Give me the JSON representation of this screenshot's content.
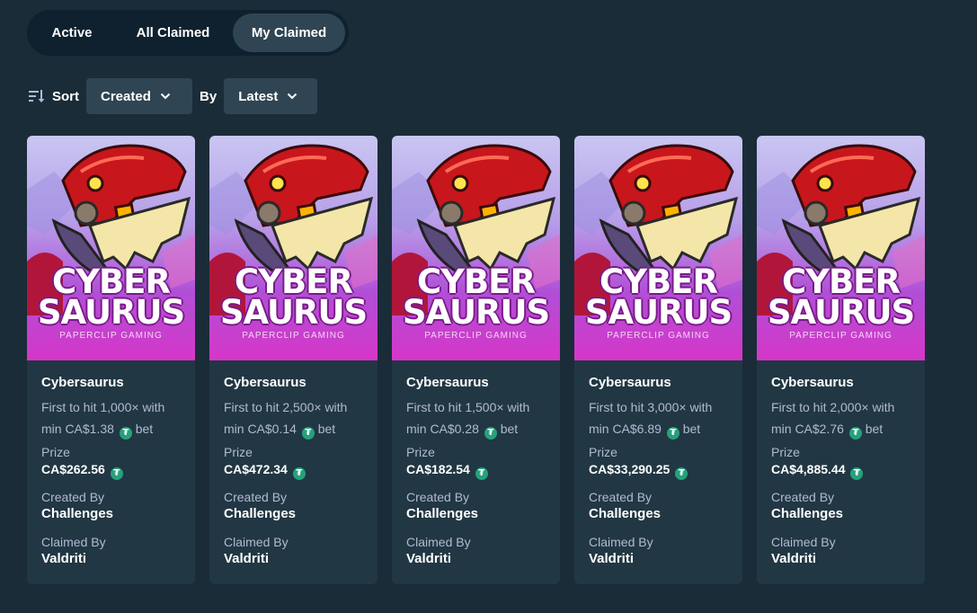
{
  "tabs": [
    {
      "label": "Active"
    },
    {
      "label": "All Claimed"
    },
    {
      "label": "My Claimed"
    }
  ],
  "sort": {
    "label": "Sort",
    "field": "Created",
    "by_label": "By",
    "order": "Latest"
  },
  "labels": {
    "prize": "Prize",
    "created_by": "Created By",
    "claimed_by": "Claimed By"
  },
  "game_art": {
    "line1": "CYBER",
    "line2": "SAURUS",
    "studio": "PAPERCLIP GAMING"
  },
  "currency_icon": "tether-coin-icon",
  "cards": [
    {
      "title": "Cybersaurus",
      "line1": "First to hit 1,000× with",
      "line2": "min CA$1.38",
      "bet": "bet",
      "prize": "CA$262.56",
      "created_by": "Challenges",
      "claimed_by": "Valdriti"
    },
    {
      "title": "Cybersaurus",
      "line1": "First to hit 2,500× with",
      "line2": "min CA$0.14",
      "bet": "bet",
      "prize": "CA$472.34",
      "created_by": "Challenges",
      "claimed_by": "Valdriti"
    },
    {
      "title": "Cybersaurus",
      "line1": "First to hit 1,500× with",
      "line2": "min CA$0.28",
      "bet": "bet",
      "prize": "CA$182.54",
      "created_by": "Challenges",
      "claimed_by": "Valdriti"
    },
    {
      "title": "Cybersaurus",
      "line1": "First to hit 3,000× with",
      "line2": "min CA$6.89",
      "bet": "bet",
      "prize": "CA$33,290.25",
      "created_by": "Challenges",
      "claimed_by": "Valdriti"
    },
    {
      "title": "Cybersaurus",
      "line1": "First to hit 2,000× with",
      "line2": "min CA$2.76",
      "bet": "bet",
      "prize": "CA$4,885.44",
      "created_by": "Challenges",
      "claimed_by": "Valdriti"
    }
  ]
}
